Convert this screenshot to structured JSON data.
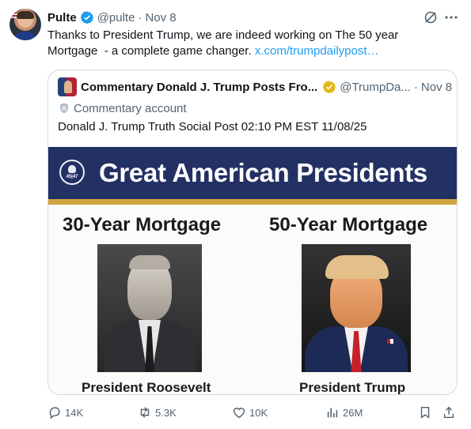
{
  "post": {
    "author_name": "Pulte",
    "handle": "@pulte",
    "separator": "·",
    "date": "Nov 8",
    "text_main": "Thanks to President Trump, we are indeed working on The 50 year\nMortgage  - a complete game changer. ",
    "link_text": "x.com/trumpdailypost…",
    "icons": {
      "verified": "verified-badge-icon",
      "grok": "grok-icon",
      "more": "more-icon"
    },
    "colors": {
      "accent": "#1d9bf0",
      "muted": "#536471",
      "border": "#cfd9de"
    }
  },
  "quote": {
    "author_name": "Commentary Donald J. Trump Posts Fro...",
    "handle": "@TrumpDa...",
    "separator": "·",
    "date": "Nov 8",
    "label": "Commentary account",
    "text": "Donald J. Trump Truth Social Post 02:10 PM EST 11/08/25",
    "badge_color": "#e2b719"
  },
  "poster": {
    "title": "Great American Presidents",
    "seal_text": "45|47",
    "left_title": "30-Year Mortgage",
    "right_title": "50-Year Mortgage",
    "left_caption": "President Roosevelt",
    "right_caption": "President Trump",
    "colors": {
      "banner": "#233063",
      "stripe": "#d2a542"
    }
  },
  "actions": {
    "reply_count": "14K",
    "retweet_count": "5.3K",
    "like_count": "10K",
    "views_count": "26M"
  }
}
